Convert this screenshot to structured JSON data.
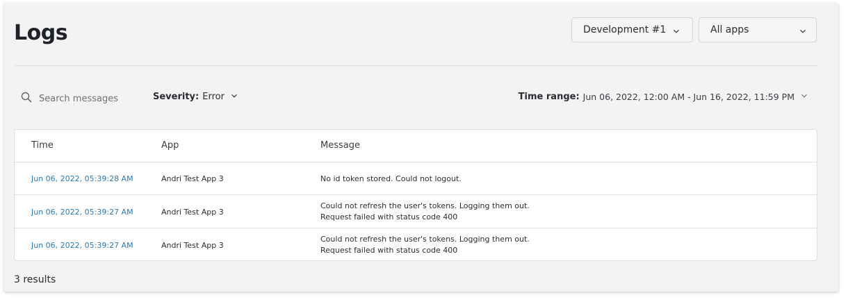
{
  "page": {
    "title": "Logs",
    "environment_selected": "Development #1",
    "app_selected": "All apps"
  },
  "filters": {
    "search_placeholder": "Search messages",
    "severity_label": "Severity:",
    "severity_value": "Error",
    "time_range_label": "Time range:",
    "time_range_value": "Jun 06, 2022, 12:00 AM - Jun 16, 2022, 11:59 PM"
  },
  "table": {
    "columns": [
      "Time",
      "App",
      "Message"
    ],
    "rows": [
      {
        "time": "Jun 06, 2022, 05:39:28 AM",
        "app": "Andri Test App 3",
        "message_lines": [
          "No id token stored. Could not logout."
        ]
      },
      {
        "time": "Jun 06, 2022, 05:39:27 AM",
        "app": "Andri Test App 3",
        "message_lines": [
          "Could not refresh the user's tokens. Logging them out.",
          "Request failed with status code 400"
        ]
      },
      {
        "time": "Jun 06, 2022, 05:39:27 AM",
        "app": "Andri Test App 3",
        "message_lines": [
          "Could not refresh the user's tokens. Logging them out.",
          "Request failed with status code 400"
        ]
      }
    ]
  },
  "results_count": "3 results",
  "colors": {
    "link": "#2a7ab8",
    "card_background": "#f3f3f4",
    "border": "#dcdee1"
  },
  "icons": {
    "search": "search-icon",
    "chevron": "chevron-down-icon"
  }
}
